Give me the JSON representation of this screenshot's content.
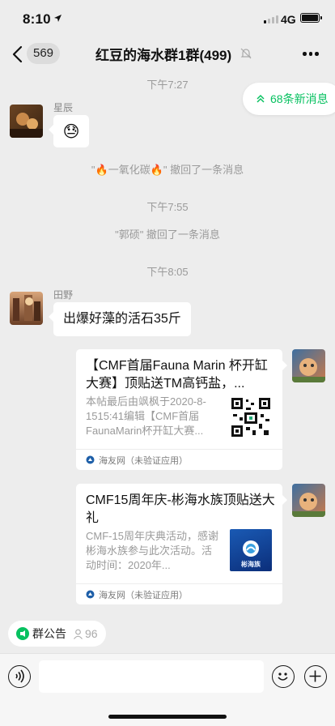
{
  "status_bar": {
    "time": "8:10",
    "network": "4G"
  },
  "header": {
    "back_count": "569",
    "title": "红豆的海水群1群(499)"
  },
  "new_messages": {
    "label": "68条新消息"
  },
  "chat": {
    "time_1": "下午7:27",
    "msg_1": {
      "sender": "星辰",
      "sticker": "😓"
    },
    "recall_1": {
      "prefix": "\"",
      "emoji_left": "🔥",
      "name": "一氧化碳",
      "emoji_right": "🔥",
      "suffix": "\" 撤回了一条消息"
    },
    "time_2": "下午7:55",
    "recall_2": "\"郭硕\" 撤回了一条消息",
    "time_3": "下午8:05",
    "msg_2": {
      "sender": "田野",
      "text": "出爆好藻的活石35斤"
    },
    "card_1": {
      "title": "【CMF首届Fauna Marin 杯开缸大赛】顶贴送TM高钙盐，...",
      "description": "本帖最后由飒枫于2020-8-1515:41编辑【CMF首届FaunaMarin杯开缸大赛...",
      "source": "海友网（未验证应用）"
    },
    "card_2": {
      "title": "CMF15周年庆-彬海水族顶贴送大礼",
      "description": "CMF-15周年庆典活动，感谢彬海水族参与此次活动。活动时间：2020年...",
      "thumb_text": "彬海族",
      "source": "海友网（未验证应用）"
    }
  },
  "bottom": {
    "notice_label": "群公告",
    "member_count": "96",
    "input_placeholder": ""
  },
  "colors": {
    "accent": "#07c160",
    "background": "#ededed"
  }
}
